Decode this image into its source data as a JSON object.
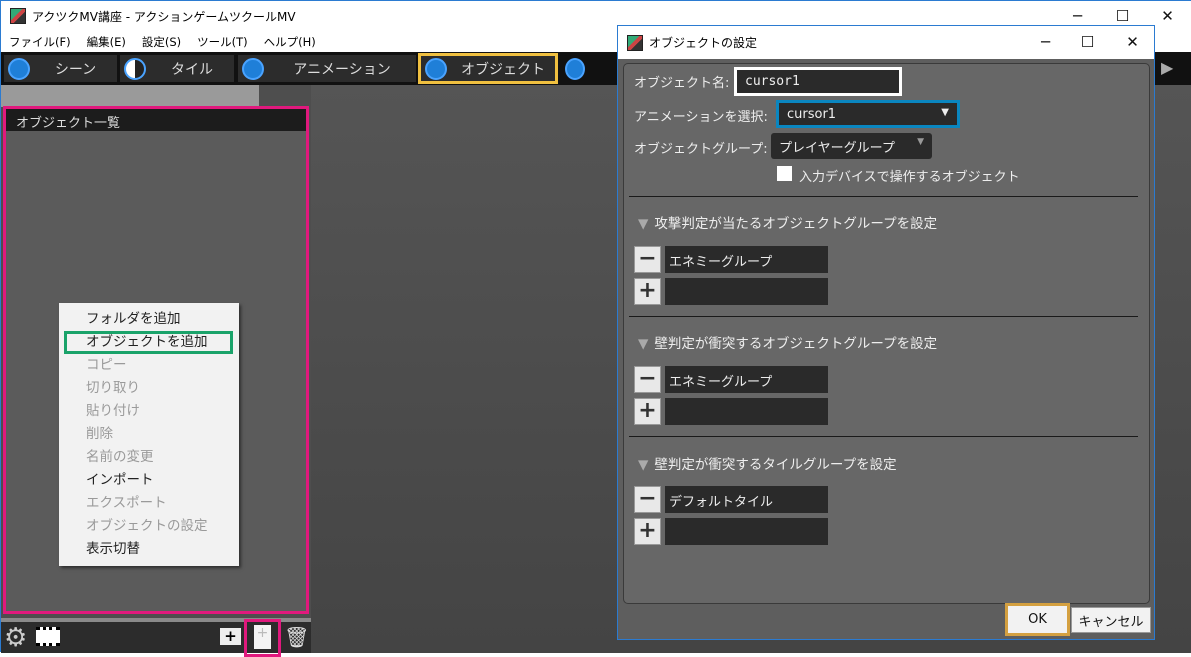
{
  "window": {
    "title": "アクツクMV講座 - アクションゲームツクールMV"
  },
  "menu": [
    "ファイル(F)",
    "編集(E)",
    "設定(S)",
    "ツール(T)",
    "ヘルプ(H)"
  ],
  "tabs": [
    {
      "label": "シーン"
    },
    {
      "label": "タイル"
    },
    {
      "label": "アニメーション"
    },
    {
      "label": "オブジェクト"
    }
  ],
  "left_panel": {
    "title": "オブジェクト一覧"
  },
  "context_menu": [
    {
      "label": "フォルダを追加",
      "enabled": true
    },
    {
      "label": "オブジェクトを追加",
      "enabled": true
    },
    {
      "label": "コピー",
      "enabled": false
    },
    {
      "label": "切り取り",
      "enabled": false
    },
    {
      "label": "貼り付け",
      "enabled": false
    },
    {
      "label": "削除",
      "enabled": false
    },
    {
      "label": "名前の変更",
      "enabled": false
    },
    {
      "label": "インポート",
      "enabled": true
    },
    {
      "label": "エクスポート",
      "enabled": false
    },
    {
      "label": "オブジェクトの設定",
      "enabled": false
    },
    {
      "label": "表示切替",
      "enabled": true
    }
  ],
  "dialog": {
    "title": "オブジェクトの設定",
    "name_label": "オブジェクト名:",
    "name_value": "cursor1",
    "anim_label": "アニメーションを選択:",
    "anim_value": "cursor1",
    "group_label": "オブジェクトグループ:",
    "group_value": "プレイヤーグループ",
    "input_device_label": "入力デバイスで操作するオブジェクト",
    "sections": [
      {
        "title": "攻撃判定が当たるオブジェクトグループを設定",
        "item": "エネミーグループ"
      },
      {
        "title": "壁判定が衝突するオブジェクトグループを設定",
        "item": "エネミーグループ"
      },
      {
        "title": "壁判定が衝突するタイルグループを設定",
        "item": "デフォルトタイル"
      }
    ],
    "ok": "OK",
    "cancel": "キャンセル"
  },
  "colors": {
    "highlight_pink": "#e0197d",
    "highlight_gold": "#f0c040",
    "highlight_green": "#1aa36a",
    "highlight_blue": "#0a86c0"
  }
}
